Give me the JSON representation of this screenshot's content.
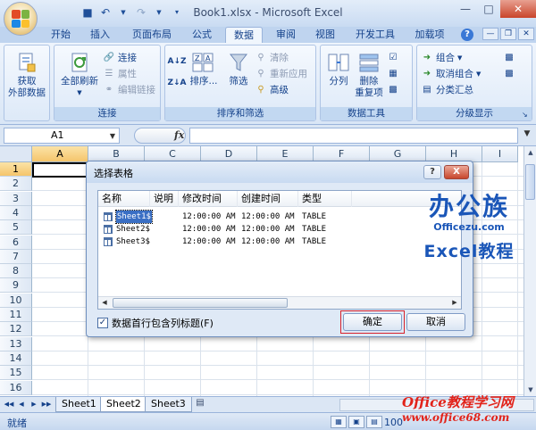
{
  "window": {
    "title": "Book1.xlsx - Microsoft Excel"
  },
  "qat": {
    "save_icon": "save-icon",
    "undo_icon": "undo-icon",
    "redo_icon": "redo-icon"
  },
  "tabs": [
    {
      "label": "开始"
    },
    {
      "label": "插入"
    },
    {
      "label": "页面布局"
    },
    {
      "label": "公式"
    },
    {
      "label": "数据"
    },
    {
      "label": "审阅"
    },
    {
      "label": "视图"
    },
    {
      "label": "开发工具"
    },
    {
      "label": "加载项"
    }
  ],
  "ribbon": {
    "get_external": "获取\n外部数据",
    "connections": {
      "refresh_all": "全部刷新",
      "connections": "连接",
      "properties": "属性",
      "edit_links": "编辑链接",
      "label": "连接"
    },
    "sort_filter": {
      "sort": "排序...",
      "filter": "筛选",
      "clear": "清除",
      "reapply": "重新应用",
      "advanced": "高级",
      "label": "排序和筛选"
    },
    "data_tools": {
      "text_to_columns": "分列",
      "remove_duplicates": "删除\n重复项",
      "label": "数据工具"
    },
    "outline": {
      "group": "组合",
      "ungroup": "取消组合",
      "subtotal": "分类汇总",
      "label": "分级显示"
    }
  },
  "formula_bar": {
    "name_box": "A1",
    "fx": "fx",
    "value": ""
  },
  "grid": {
    "columns": [
      "A",
      "B",
      "C",
      "D",
      "E",
      "F",
      "G",
      "H",
      "I"
    ],
    "rows": [
      "1",
      "2",
      "3",
      "4",
      "5",
      "6",
      "7",
      "8",
      "9",
      "10",
      "11",
      "12",
      "13",
      "14",
      "15",
      "16"
    ]
  },
  "dialog": {
    "title": "选择表格",
    "help": "?",
    "close": "X",
    "columns": [
      "名称",
      "说明",
      "修改时间",
      "创建时间",
      "类型"
    ],
    "rows": [
      {
        "name": "Sheet1$",
        "desc": "",
        "modified": "12:00:00 AM",
        "created": "12:00:00 AM",
        "type": "TABLE"
      },
      {
        "name": "Sheet2$",
        "desc": "",
        "modified": "12:00:00 AM",
        "created": "12:00:00 AM",
        "type": "TABLE"
      },
      {
        "name": "Sheet3$",
        "desc": "",
        "modified": "12:00:00 AM",
        "created": "12:00:00 AM",
        "type": "TABLE"
      }
    ],
    "checkbox_label": "数据首行包含列标题(F)",
    "checkbox_checked": "✓",
    "ok": "确定",
    "cancel": "取消"
  },
  "sheets": [
    {
      "label": "Sheet1"
    },
    {
      "label": "Sheet2"
    },
    {
      "label": "Sheet3"
    }
  ],
  "status": {
    "ready": "就绪",
    "zoom": "100"
  },
  "watermark": {
    "brand_cn": "办公族",
    "brand_en": "Officezu.com",
    "brand_excel": "Excel教程",
    "site_title": "Office教程学习网",
    "site_url": "www.office68.com"
  },
  "colors": {
    "accent": "#15428b",
    "close": "#c7462c",
    "selection": "#3a6fc4",
    "ok_highlight": "#d8202a"
  }
}
